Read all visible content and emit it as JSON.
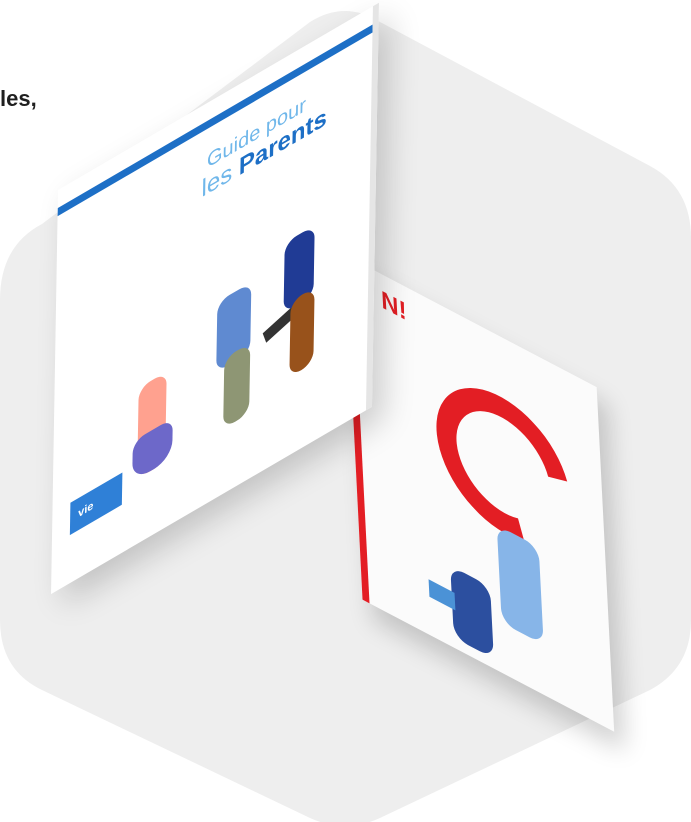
{
  "partial_heading": "les,",
  "front_brochure": {
    "title_line_1": "Guide pour",
    "title_line_2_light": "les",
    "title_line_2_bold": "Parents",
    "logo_text": "vie"
  },
  "back_brochure": {
    "title": "N!"
  },
  "colors": {
    "hexagon_background": "#eeeeee",
    "brand_blue": "#1d6fc6",
    "light_blue": "#70b7ea",
    "red": "#e31e24"
  }
}
